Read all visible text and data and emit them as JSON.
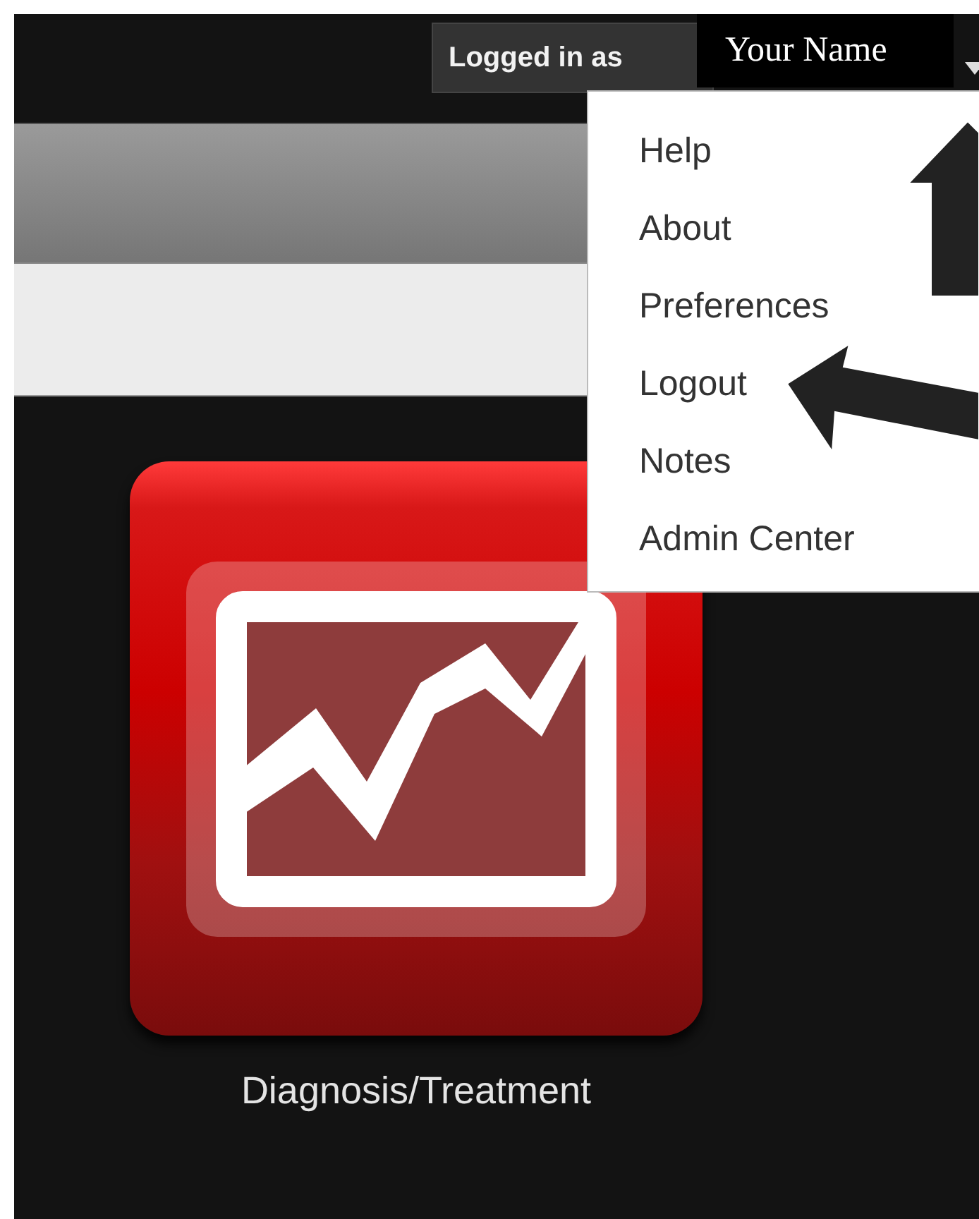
{
  "user_menu": {
    "label": "Logged in as",
    "name": "Your Name",
    "expanded": true,
    "items": [
      {
        "label": "Help"
      },
      {
        "label": "About"
      },
      {
        "label": "Preferences"
      },
      {
        "label": "Logout"
      },
      {
        "label": "Notes"
      },
      {
        "label": "Admin Center"
      }
    ]
  },
  "tiles": [
    {
      "label": "Diagnosis/Treatment"
    }
  ]
}
